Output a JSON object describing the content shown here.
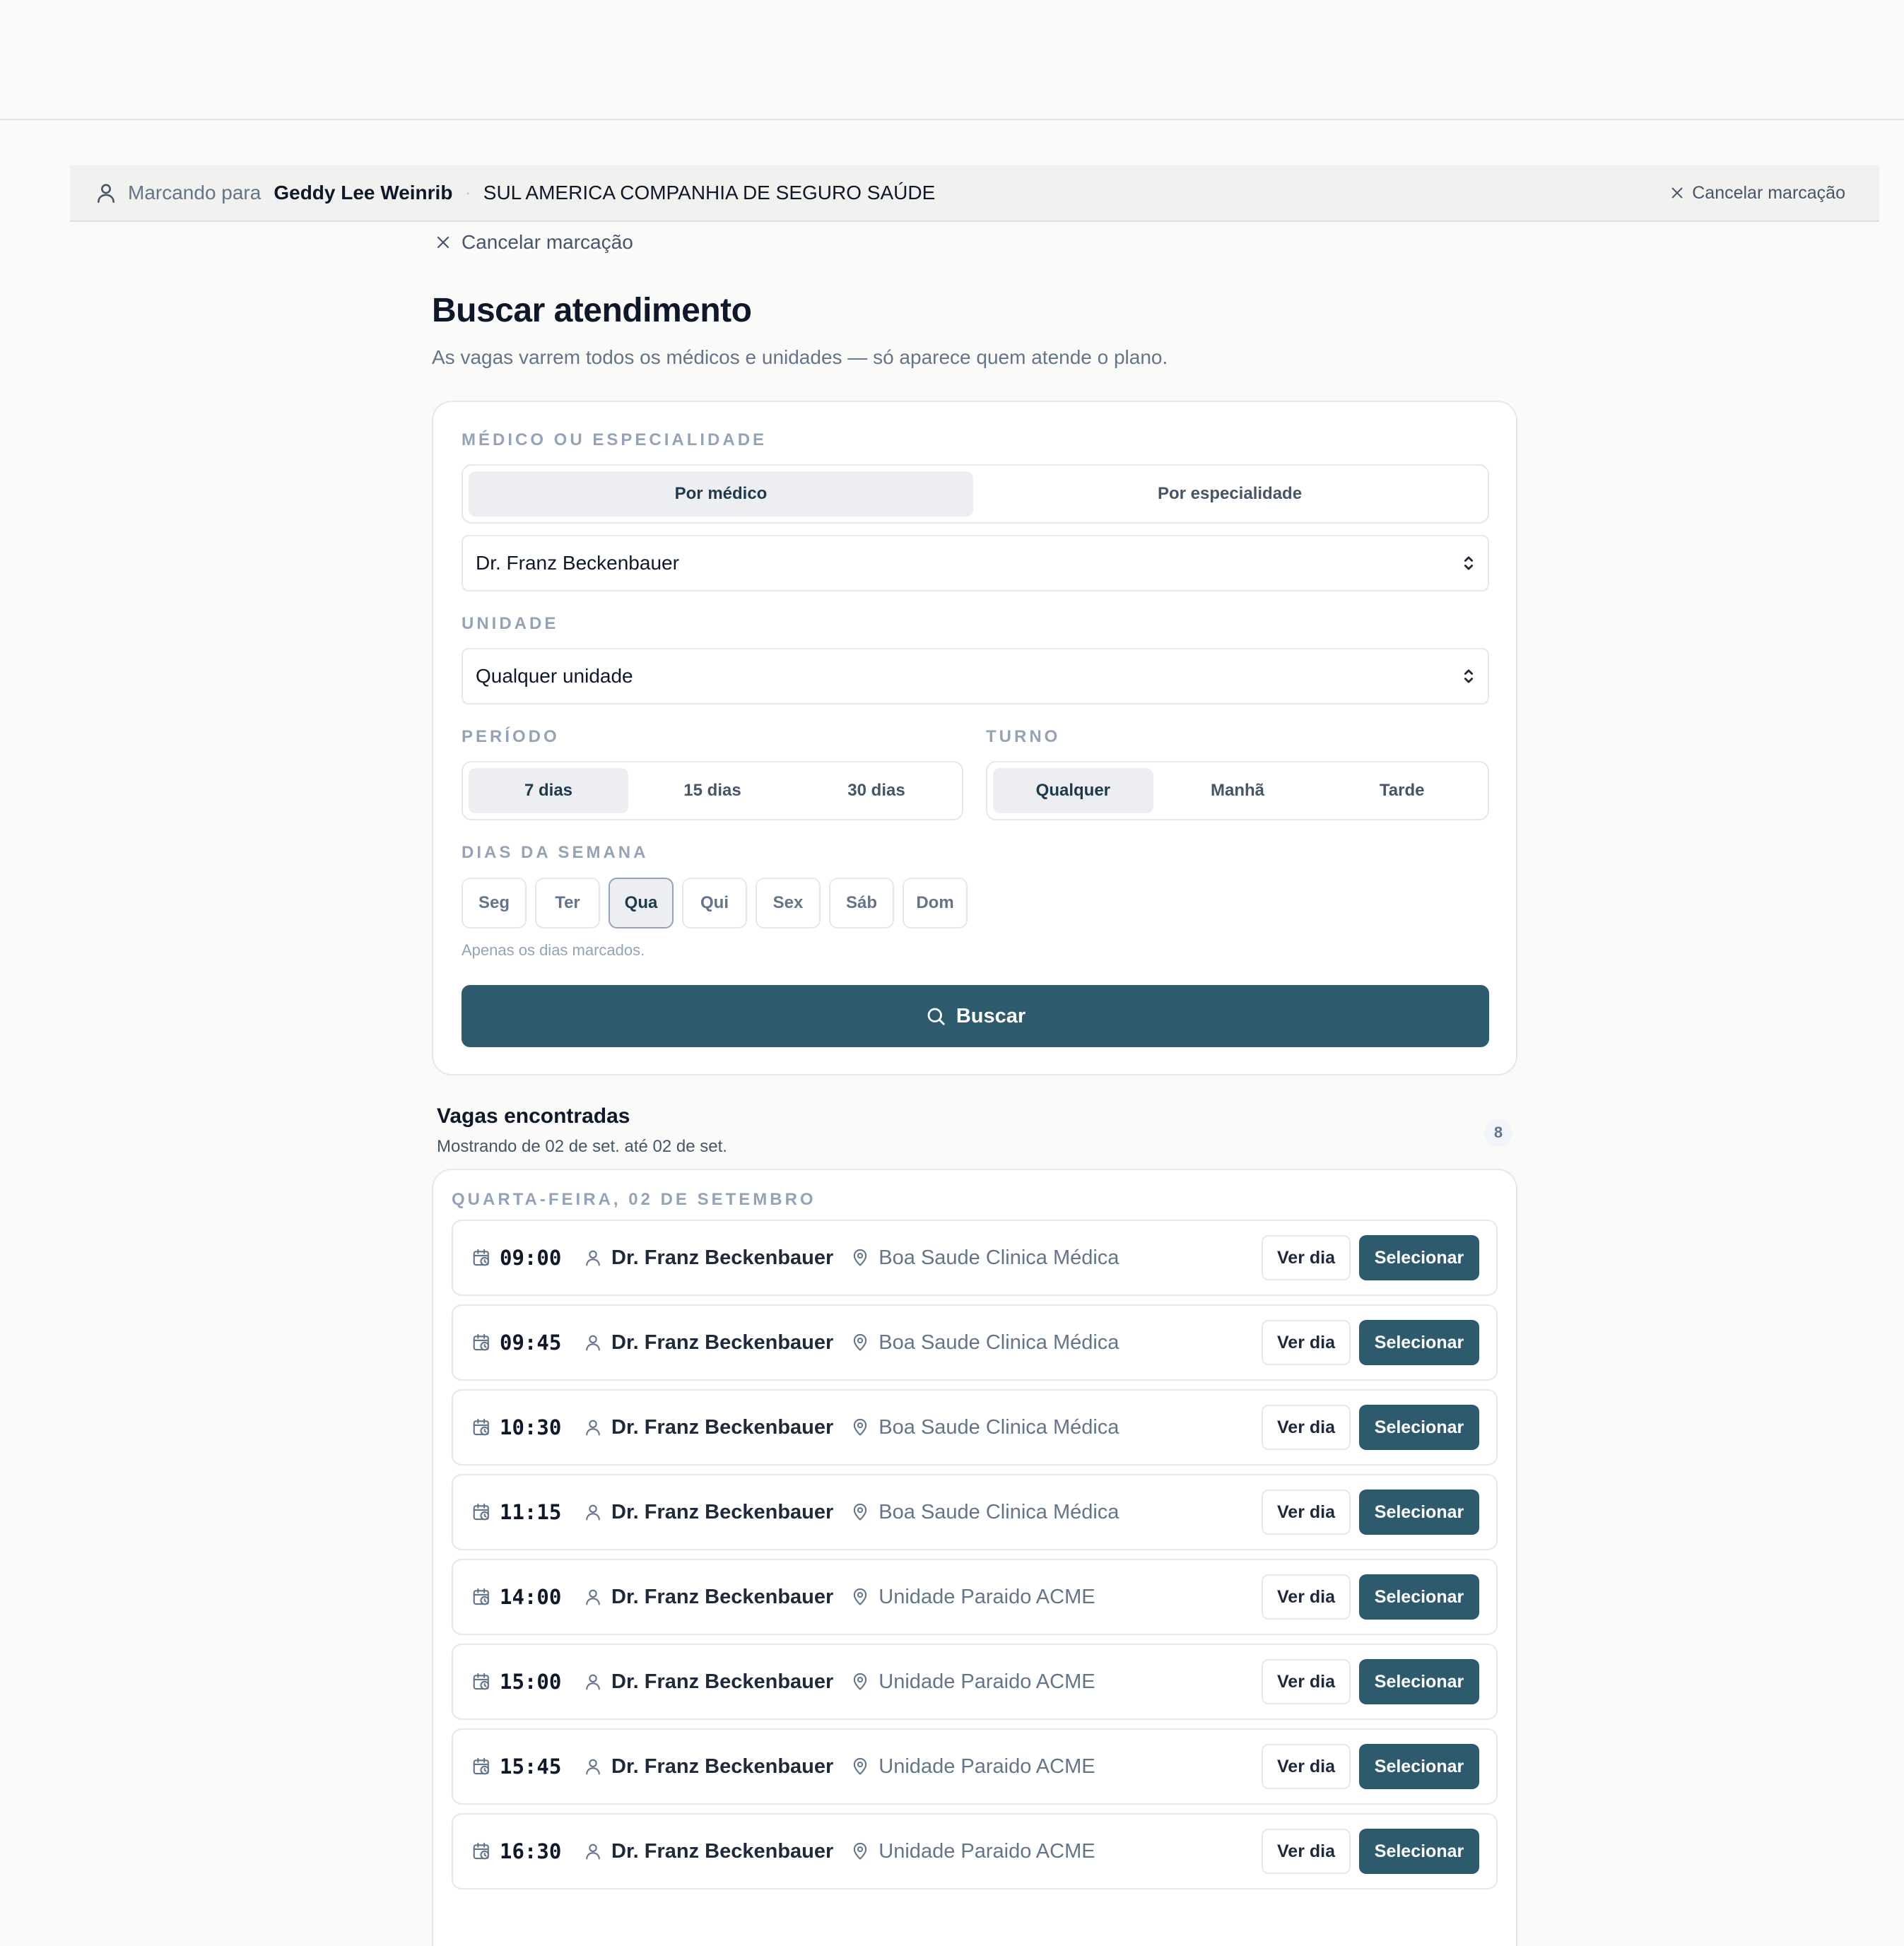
{
  "banner": {
    "label": "Marcando para",
    "patient": "Geddy Lee Weinrib",
    "separator": "·",
    "plan": "SUL AMERICA COMPANHIA DE SEGURO SAÚDE",
    "cancel": "Cancelar marcação"
  },
  "page": {
    "back_cancel": "Cancelar marcação",
    "title": "Buscar atendimento",
    "subtitle": "As vagas varrem todos os médicos e unidades — só aparece quem atende o plano."
  },
  "form": {
    "doctor_section": "MÉDICO OU ESPECIALIDADE",
    "mode_by_doctor": "Por médico",
    "mode_by_specialty": "Por especialidade",
    "doctor_value": "Dr. Franz Beckenbauer",
    "unit_section": "UNIDADE",
    "unit_value": "Qualquer unidade",
    "period_section": "PERÍODO",
    "period_options": [
      "7 dias",
      "15 dias",
      "30 dias"
    ],
    "shift_section": "TURNO",
    "shift_options": [
      "Qualquer",
      "Manhã",
      "Tarde"
    ],
    "weekdays_section": "DIAS DA SEMANA",
    "weekdays": [
      "Seg",
      "Ter",
      "Qua",
      "Qui",
      "Sex",
      "Sáb",
      "Dom"
    ],
    "weekdays_hint": "Apenas os dias marcados.",
    "search_button": "Buscar"
  },
  "results": {
    "title": "Vagas encontradas",
    "range": "Mostrando de 02 de set. até 02 de set.",
    "count": "8",
    "day_label": "QUARTA-FEIRA, 02 DE SETEMBRO",
    "view_day_label": "Ver dia",
    "select_label": "Selecionar",
    "slots": [
      {
        "time": "09:00",
        "doctor": "Dr. Franz Beckenbauer",
        "unit": "Boa Saude Clinica Médica"
      },
      {
        "time": "09:45",
        "doctor": "Dr. Franz Beckenbauer",
        "unit": "Boa Saude Clinica Médica"
      },
      {
        "time": "10:30",
        "doctor": "Dr. Franz Beckenbauer",
        "unit": "Boa Saude Clinica Médica"
      },
      {
        "time": "11:15",
        "doctor": "Dr. Franz Beckenbauer",
        "unit": "Boa Saude Clinica Médica"
      },
      {
        "time": "14:00",
        "doctor": "Dr. Franz Beckenbauer",
        "unit": "Unidade Paraido ACME"
      },
      {
        "time": "15:00",
        "doctor": "Dr. Franz Beckenbauer",
        "unit": "Unidade Paraido ACME"
      },
      {
        "time": "15:45",
        "doctor": "Dr. Franz Beckenbauer",
        "unit": "Unidade Paraido ACME"
      },
      {
        "time": "16:30",
        "doctor": "Dr. Franz Beckenbauer",
        "unit": "Unidade Paraido ACME"
      }
    ]
  },
  "icons": {
    "banner_user": "user-icon",
    "close": "close-icon",
    "select_chevron": "chevron-up-down-icon",
    "search": "search-icon",
    "slot_calendar": "calendar-clock-icon",
    "slot_doctor": "user-icon",
    "slot_location": "map-pin-icon"
  },
  "colors": {
    "primary": "#2e5a6e",
    "background": "#fafaf9",
    "active_segment": "#eceef1",
    "muted_text": "#64748b",
    "section_label": "#94a3b8"
  }
}
